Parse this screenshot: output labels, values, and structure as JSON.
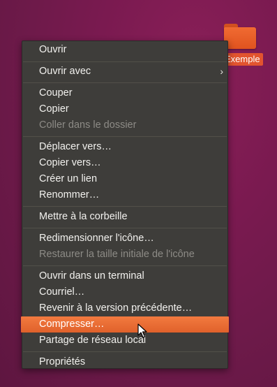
{
  "desktop": {
    "folder_label": "Exemple"
  },
  "menu": {
    "items": [
      {
        "label": "Ouvrir",
        "disabled": false
      },
      {
        "label": "Ouvrir avec",
        "disabled": false,
        "submenu": true
      },
      {
        "label": "Couper",
        "disabled": false
      },
      {
        "label": "Copier",
        "disabled": false
      },
      {
        "label": "Coller dans le dossier",
        "disabled": true
      },
      {
        "label": "Déplacer vers…",
        "disabled": false
      },
      {
        "label": "Copier vers…",
        "disabled": false
      },
      {
        "label": "Créer un lien",
        "disabled": false
      },
      {
        "label": "Renommer…",
        "disabled": false
      },
      {
        "label": "Mettre à la corbeille",
        "disabled": false
      },
      {
        "label": "Redimensionner l'icône…",
        "disabled": false
      },
      {
        "label": "Restaurer la taille initiale de l'icône",
        "disabled": true
      },
      {
        "label": "Ouvrir dans un terminal",
        "disabled": false
      },
      {
        "label": "Courriel…",
        "disabled": false
      },
      {
        "label": "Revenir à la version précédente…",
        "disabled": false
      },
      {
        "label": "Compresser…",
        "disabled": false,
        "highlighted": true
      },
      {
        "label": "Partage de réseau local",
        "disabled": false
      },
      {
        "label": "Propriétés",
        "disabled": false
      }
    ],
    "submenu_arrow": "›"
  },
  "colors": {
    "accent": "#e95420",
    "menu_bg": "#3e3d3a",
    "desktop_bg": "#77216f"
  }
}
